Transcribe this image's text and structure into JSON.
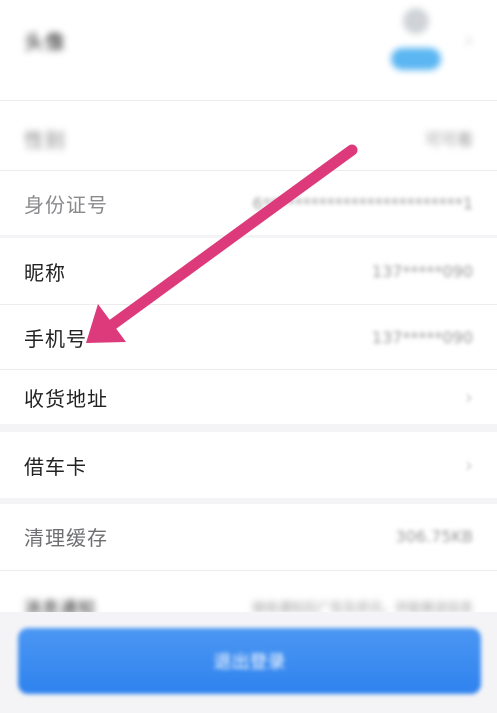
{
  "profile": {
    "avatar_label": "头像",
    "gender_label": "性别",
    "gender_value": "可可看",
    "id_label": "身份证号",
    "id_value": "6*************************1",
    "nickname_label": "昵称",
    "nickname_value": "137*****090",
    "phone_label": "手机号",
    "phone_value": "137*****090",
    "address_label": "收货地址",
    "card_label": "借车卡",
    "cache_label": "清理缓存",
    "cache_value": "306.75KB",
    "notify_label": "消息通知",
    "notify_value": "接收通知后广告及资讯，并能推送信息",
    "logout_label": "退出登录"
  },
  "annotation": {
    "arrow_color": "#dd3a7c"
  }
}
